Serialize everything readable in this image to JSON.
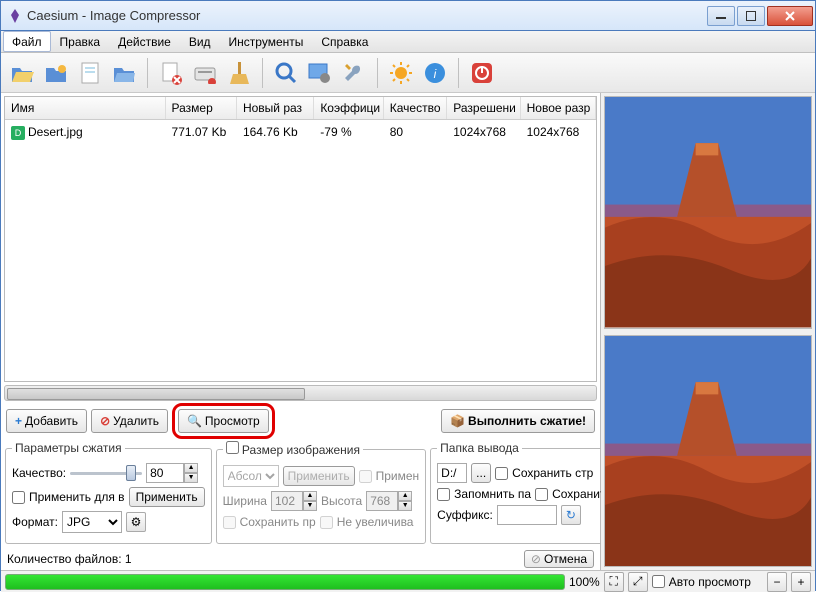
{
  "window": {
    "title": "Caesium - Image Compressor"
  },
  "menu": {
    "items": [
      "Файл",
      "Правка",
      "Действие",
      "Вид",
      "Инструменты",
      "Справка"
    ],
    "active_index": 0
  },
  "toolbar_icons": [
    "folder-open-icon",
    "folder-sun-icon",
    "document-icon",
    "folder-plain-icon",
    "doc-delete-icon",
    "drive-icon",
    "broom-icon",
    "magnifier-icon",
    "picture-gear-icon",
    "wrench-icon",
    "sun-icon",
    "info-icon",
    "power-icon"
  ],
  "table": {
    "columns": [
      "Имя",
      "Размер",
      "Новый раз",
      "Коэффици",
      "Качество",
      "Разрешени",
      "Новое разр"
    ],
    "rows": [
      {
        "name": "Desert.jpg",
        "size": "771.07 Kb",
        "new_size": "164.76 Kb",
        "ratio": "-79 %",
        "quality": "80",
        "resolution": "1024x768",
        "new_resolution": "1024x768"
      }
    ]
  },
  "actions": {
    "add": "Добавить",
    "remove": "Удалить",
    "preview": "Просмотр",
    "compress": "Выполнить сжатие!"
  },
  "compression": {
    "legend": "Параметры сжатия",
    "quality_label": "Качество:",
    "quality_value": "80",
    "apply_all": "Применить для в",
    "apply_btn": "Применить",
    "format_label": "Формат:",
    "format_value": "JPG"
  },
  "resize": {
    "legend": "Размер изображения",
    "mode": "Абсолю",
    "apply_each": "Применить",
    "apply_cb": "Примен",
    "width_label": "Ширина",
    "width_value": "102",
    "height_label": "Высота",
    "height_value": "768",
    "keep_cb": "Сохранить пр",
    "noup_cb": "Не увеличива"
  },
  "output": {
    "legend": "Папка вывода",
    "path": "D:/",
    "browse": "...",
    "keep_struct": "Сохранить стр",
    "remember": "Запомнить па",
    "save_in": "Сохранить в п",
    "suffix_label": "Суффикс:",
    "suffix_value": ""
  },
  "status": {
    "file_count_label": "Количество файлов: 1",
    "cancel": "Отмена",
    "progress_pct": "100%",
    "auto_preview": "Авто просмотр"
  },
  "colors": {
    "highlight": "#e00000",
    "progress": "#1fbf1f"
  }
}
